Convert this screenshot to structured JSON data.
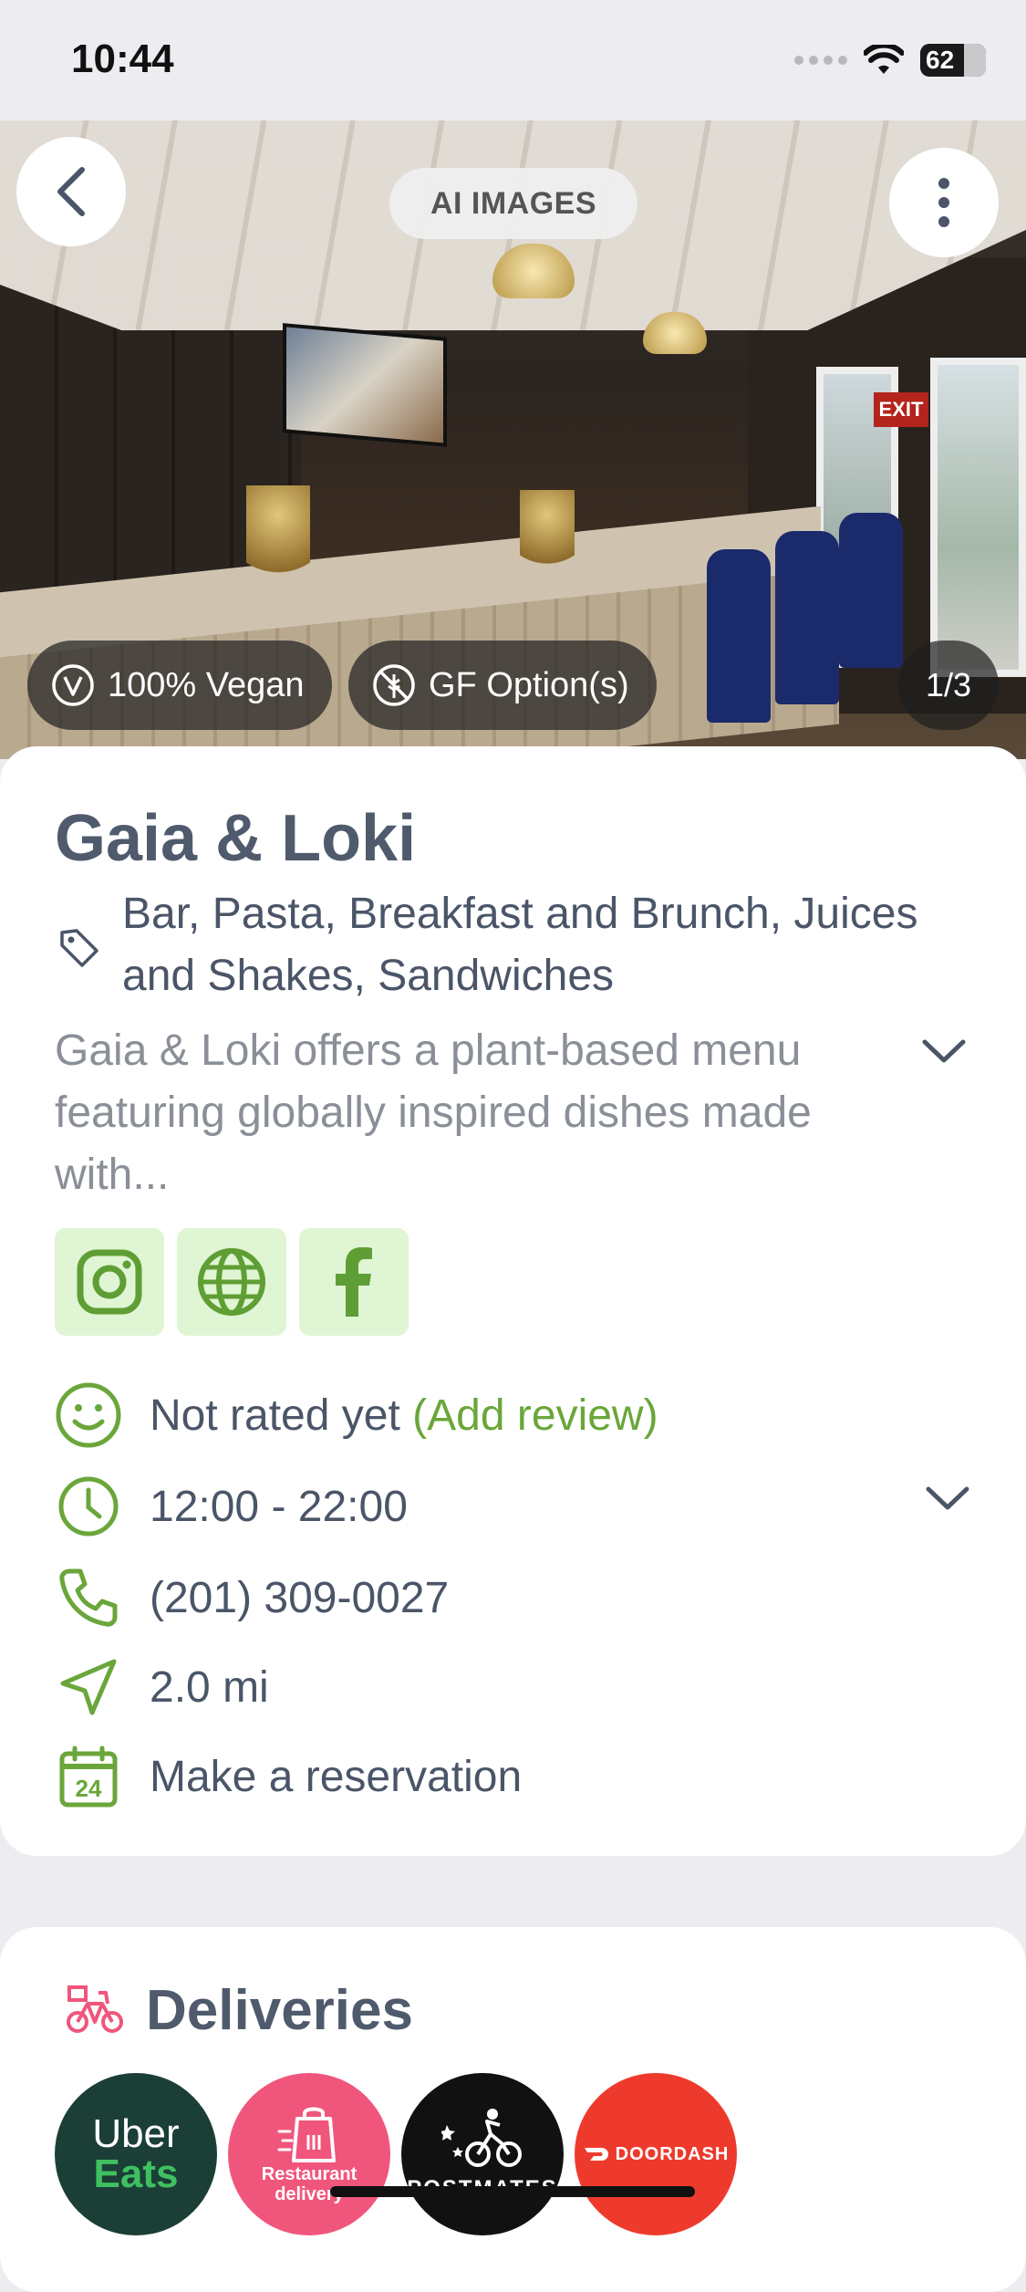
{
  "status_bar": {
    "time": "10:44",
    "battery": "62"
  },
  "hero": {
    "ai_label": "AI IMAGES",
    "tags": [
      {
        "label": "100% Vegan",
        "icon": "vegan-v-icon"
      },
      {
        "label": "GF Option(s)",
        "icon": "gluten-free-icon"
      }
    ],
    "counter": "1/3",
    "exit_sign": "EXIT"
  },
  "restaurant": {
    "name": "Gaia & Loki",
    "categories": "Bar, Pasta, Breakfast and Brunch, Juices and Shakes, Sandwiches",
    "description": "Gaia & Loki offers a plant-based menu featuring globally inspired dishes made with...",
    "rating_text": "Not rated yet",
    "add_review": "(Add review)",
    "hours": "12:00 - 22:00",
    "phone": "(201) 309-0027",
    "distance": "2.0 mi",
    "reservation": "Make a reservation",
    "calendar_day": "24"
  },
  "socials": [
    "instagram",
    "website",
    "facebook"
  ],
  "deliveries": {
    "title": "Deliveries",
    "services": [
      {
        "line1": "Uber",
        "line2": "Eats",
        "color": "#1b3f36"
      },
      {
        "line1": "Restaurant",
        "line2": "delivery",
        "color": "#f0567c"
      },
      {
        "line1": "POSTMATES",
        "line2": "",
        "color": "#111111"
      },
      {
        "line1": "DOORDASH",
        "line2": "",
        "color": "#ee3a2c"
      }
    ]
  },
  "colors": {
    "accent_green": "#6aa63a",
    "social_bg": "#e0f5d4",
    "delivery_pink": "#f0567c"
  }
}
